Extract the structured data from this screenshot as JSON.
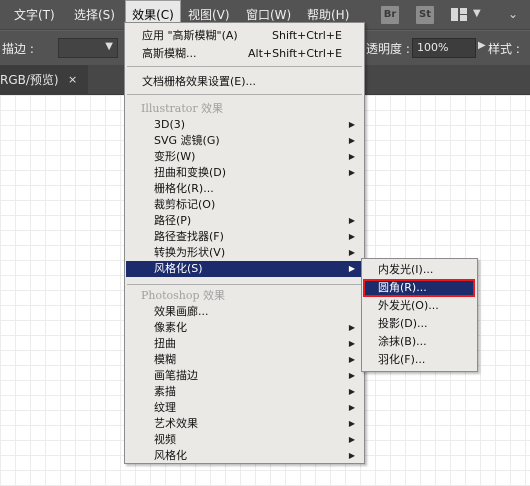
{
  "menubar": {
    "items": [
      "文字(T)",
      "选择(S)",
      "效果(C)",
      "视图(V)",
      "窗口(W)",
      "帮助(H)"
    ],
    "active": "效果(C)",
    "app_icons": [
      "Br",
      "St"
    ],
    "workspace_icon": "grid-layout-icon"
  },
  "controlbar": {
    "stroke_label": "描边 :",
    "opacity_label": "透明度 :",
    "opacity_value": "100%",
    "style_label": "样式 :"
  },
  "tabbar": {
    "doc_tab": "RGB/预览)",
    "close": "×"
  },
  "effect_menu": {
    "apply_last": {
      "label": "应用 \"高斯模糊\"(A)",
      "shortcut": "Shift+Ctrl+E"
    },
    "last_effect": {
      "label": "高斯模糊...",
      "shortcut": "Alt+Shift+Ctrl+E"
    },
    "raster_settings": "文档栅格效果设置(E)...",
    "illustrator_header": "Illustrator 效果",
    "illustrator_items": [
      "3D(3)",
      "SVG 滤镜(G)",
      "变形(W)",
      "扭曲和变换(D)",
      "栅格化(R)...",
      "裁剪标记(O)",
      "路径(P)",
      "路径查找器(F)",
      "转换为形状(V)",
      "风格化(S)"
    ],
    "photoshop_header": "Photoshop 效果",
    "photoshop_items": [
      "效果画廊...",
      "像素化",
      "扭曲",
      "模糊",
      "画笔描边",
      "素描",
      "纹理",
      "艺术效果",
      "视频",
      "风格化"
    ]
  },
  "stylize_submenu": {
    "items": [
      "内发光(I)...",
      "圆角(R)...",
      "外发光(O)...",
      "投影(D)...",
      "涂抹(B)...",
      "羽化(F)..."
    ],
    "highlighted": "圆角(R)..."
  },
  "colors": {
    "menubar_bg": "#535353",
    "highlight": "#1c2b6b",
    "outline_red": "#e8181d"
  }
}
